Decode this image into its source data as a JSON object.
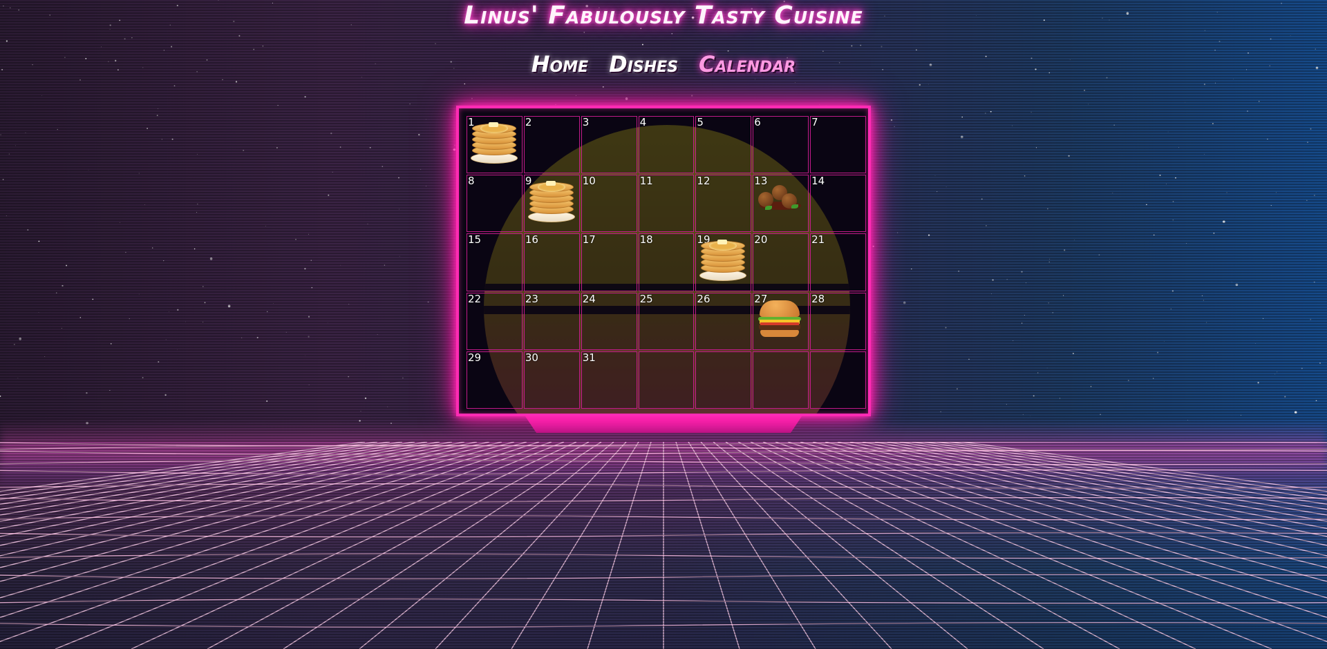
{
  "site": {
    "title": "Linus' Fabulously Tasty Cuisine"
  },
  "nav": {
    "items": [
      {
        "label": "Home",
        "active": false
      },
      {
        "label": "Dishes",
        "active": false
      },
      {
        "label": "Calendar",
        "active": true
      }
    ]
  },
  "calendar": {
    "days": [
      {
        "day": "1",
        "dish": "pancakes-icon"
      },
      {
        "day": "2"
      },
      {
        "day": "3"
      },
      {
        "day": "4"
      },
      {
        "day": "5"
      },
      {
        "day": "6"
      },
      {
        "day": "7"
      },
      {
        "day": "8"
      },
      {
        "day": "9",
        "dish": "pancakes-icon"
      },
      {
        "day": "10"
      },
      {
        "day": "11"
      },
      {
        "day": "12"
      },
      {
        "day": "13",
        "dish": "meatballs-icon"
      },
      {
        "day": "14"
      },
      {
        "day": "15"
      },
      {
        "day": "16"
      },
      {
        "day": "17"
      },
      {
        "day": "18"
      },
      {
        "day": "19",
        "dish": "pancakes-icon"
      },
      {
        "day": "20"
      },
      {
        "day": "21"
      },
      {
        "day": "22"
      },
      {
        "day": "23"
      },
      {
        "day": "24"
      },
      {
        "day": "25"
      },
      {
        "day": "26"
      },
      {
        "day": "27",
        "dish": "burger-icon"
      },
      {
        "day": "28"
      },
      {
        "day": "29"
      },
      {
        "day": "30"
      },
      {
        "day": "31"
      },
      {
        "day": ""
      },
      {
        "day": ""
      },
      {
        "day": ""
      },
      {
        "day": ""
      }
    ]
  },
  "colors": {
    "neon_pink": "#ff2bb4",
    "cell_border": "#c21a8a",
    "active_nav": "#ff9be3"
  }
}
